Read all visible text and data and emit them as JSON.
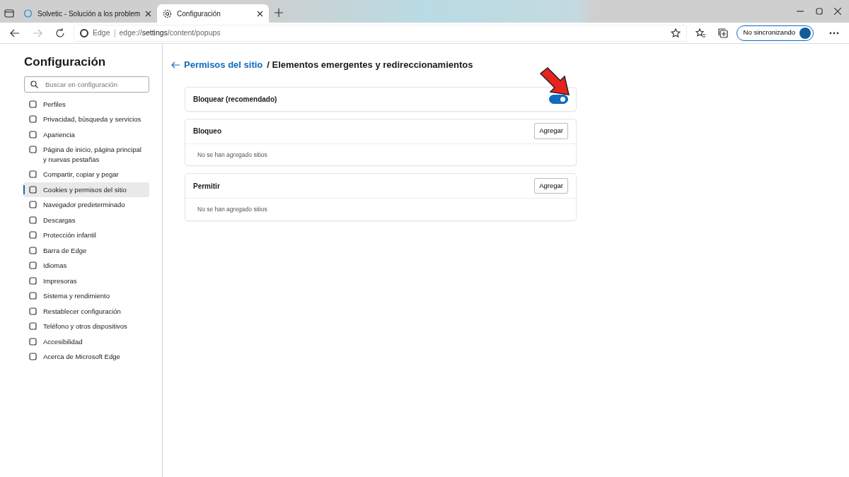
{
  "tabs": [
    {
      "label": "Solvetic - Solución a los problem",
      "selected": false
    },
    {
      "label": "Configuración",
      "selected": true
    }
  ],
  "address_bar": {
    "brand": "Edge",
    "url_prefix": "edge://",
    "url_host": "settings",
    "url_path": "/content/popups"
  },
  "profile_button": {
    "label": "No sincronizando"
  },
  "sidebar": {
    "title": "Configuración",
    "search": {
      "placeholder": "Buscar en configuración"
    },
    "items": [
      {
        "label": "Perfiles",
        "selected": false
      },
      {
        "label": "Privacidad, búsqueda y servicios",
        "selected": false
      },
      {
        "label": "Apariencia",
        "selected": false
      },
      {
        "label": "Página de inicio, página principal y nuevas pestañas",
        "selected": false
      },
      {
        "label": "Compartir, copiar y pegar",
        "selected": false
      },
      {
        "label": "Cookies y permisos del sitio",
        "selected": true
      },
      {
        "label": "Navegador predeterminado",
        "selected": false
      },
      {
        "label": "Descargas",
        "selected": false
      },
      {
        "label": "Protección infantil",
        "selected": false
      },
      {
        "label": "Barra de Edge",
        "selected": false
      },
      {
        "label": "Idiomas",
        "selected": false
      },
      {
        "label": "Impresoras",
        "selected": false
      },
      {
        "label": "Sistema y rendimiento",
        "selected": false
      },
      {
        "label": "Restablecer configuración",
        "selected": false
      },
      {
        "label": "Teléfono y otros dispositivos",
        "selected": false
      },
      {
        "label": "Accesibilidad",
        "selected": false
      },
      {
        "label": "Acerca de Microsoft Edge",
        "selected": false
      }
    ]
  },
  "breadcrumb": {
    "link": "Permisos del sitio",
    "current": "/ Elementos emergentes y redireccionamientos"
  },
  "toggle_card": {
    "label": "Bloquear (recomendado)",
    "on": true
  },
  "lists": [
    {
      "title": "Bloqueo",
      "button": "Agregar",
      "empty_text": "No se han agregado sitios"
    },
    {
      "title": "Permitir",
      "button": "Agregar",
      "empty_text": "No se han agregado sitios"
    }
  ]
}
